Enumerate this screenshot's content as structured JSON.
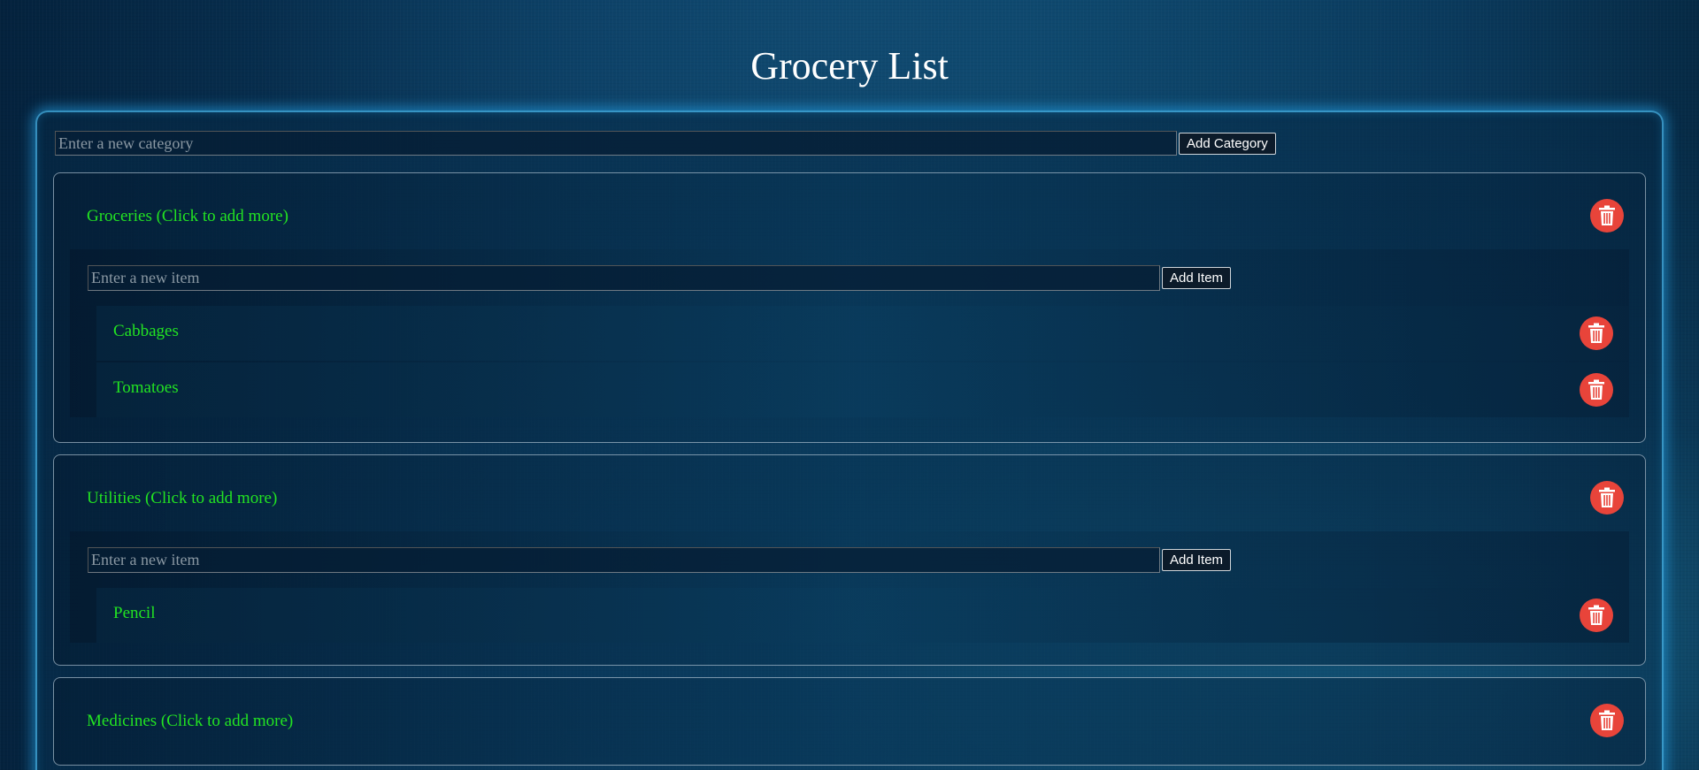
{
  "page": {
    "title": "Grocery List"
  },
  "new_category": {
    "placeholder": "Enter a new category",
    "button_label": "Add Category"
  },
  "categories": [
    {
      "header": "Groceries (Click to add more)",
      "item_input_placeholder": "Enter a new item",
      "add_item_label": "Add Item",
      "items": [
        {
          "label": "Cabbages"
        },
        {
          "label": "Tomatoes"
        }
      ]
    },
    {
      "header": "Utilities (Click to add more)",
      "item_input_placeholder": "Enter a new item",
      "add_item_label": "Add Item",
      "items": [
        {
          "label": "Pencil"
        }
      ]
    },
    {
      "header": "Medicines (Click to add more)",
      "items": []
    }
  ],
  "icons": {
    "delete": "trash-icon"
  },
  "colors": {
    "category_text": "#22e322",
    "delete_button": "#e8443a",
    "panel_glow": "#28aaf0"
  }
}
